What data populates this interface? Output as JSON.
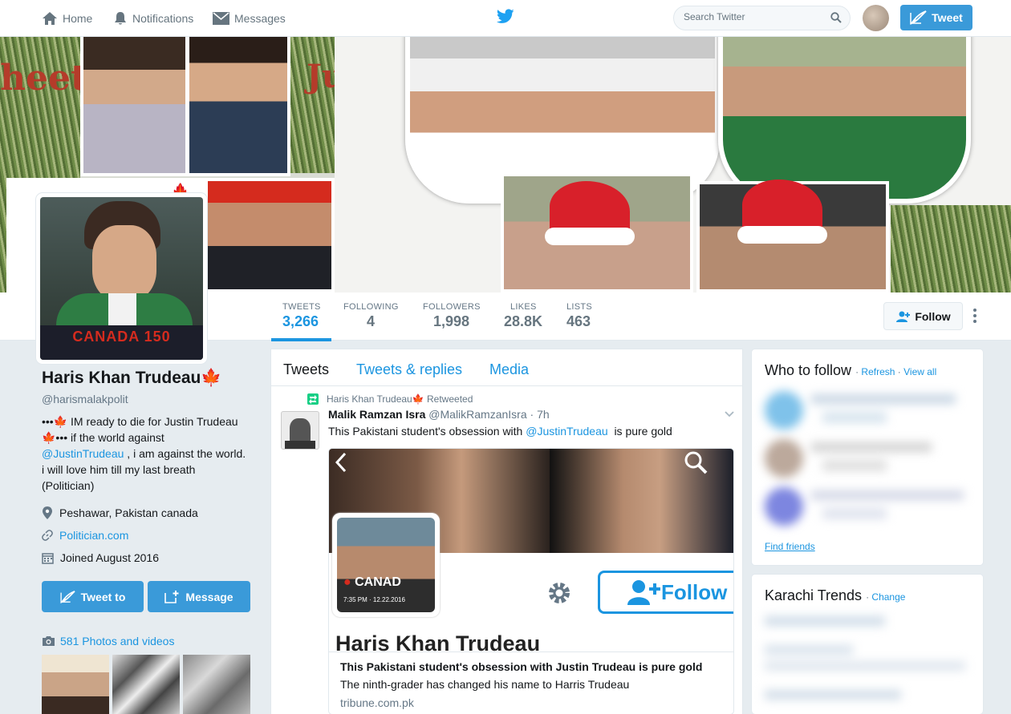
{
  "nav": {
    "home": "Home",
    "notifications": "Notifications",
    "messages": "Messages",
    "search_placeholder": "Search Twitter",
    "tweet_button": "Tweet"
  },
  "stats": [
    {
      "label": "TWEETS",
      "value": "3,266"
    },
    {
      "label": "FOLLOWING",
      "value": "4"
    },
    {
      "label": "FOLLOWERS",
      "value": "1,998"
    },
    {
      "label": "LIKES",
      "value": "28.8K"
    },
    {
      "label": "LISTS",
      "value": "463"
    }
  ],
  "follow_button": "Follow",
  "profile": {
    "name": "Haris Khan Trudeau",
    "handle": "@harismalakpolit",
    "bio_line1": "•••🍁 IM ready to die for Justin Trudeau",
    "bio_line2": "🍁••• if the world against",
    "bio_mention": "@JustinTrudeau",
    "bio_line3": " , i am against the world.",
    "bio_line4": "i will love him till my last breath",
    "bio_line5": "(Politician)",
    "location": "Peshawar, Pakistan canada",
    "website": "Politician.com",
    "joined": "Joined August 2016",
    "tweet_to": "Tweet to",
    "message": "Message",
    "photos": "581 Photos and videos",
    "avatar_banner_text": "CANADA 150"
  },
  "tabs": [
    "Tweets",
    "Tweets & replies",
    "Media"
  ],
  "tweet": {
    "retweeted_by": "Haris Khan Trudeau🍁 Retweeted",
    "author_name": "Malik Ramzan Isra",
    "author_handle": "@MalikRamzanIsra",
    "time": "7h",
    "text_before": "This Pakistani student's obsession with ",
    "mention": "@JustinTrudeau",
    "text_after": "  is pure gold",
    "card": {
      "image_name_text": "Haris Khan Trudeau",
      "image_follow_text": "Follow",
      "image_canada_text": "CANAD",
      "image_timestamp": "7:35 PM · 12.22.2016",
      "title": "This Pakistani student's obsession with Justin Trudeau is pure gold",
      "description": "The ninth-grader has changed his name to Harris Trudeau",
      "url": "tribune.com.pk"
    }
  },
  "who_to_follow": {
    "title": "Who to follow",
    "refresh": "Refresh",
    "view_all": "View all",
    "find_friends": "Find friends"
  },
  "trends": {
    "title": "Karachi Trends",
    "change": "Change"
  },
  "banner_text": {
    "left": "heet",
    "right_top": "Ju"
  },
  "colors": {
    "accent": "#1b95e0",
    "button": "#3a9ad9",
    "canada_red": "#d52b1e"
  }
}
